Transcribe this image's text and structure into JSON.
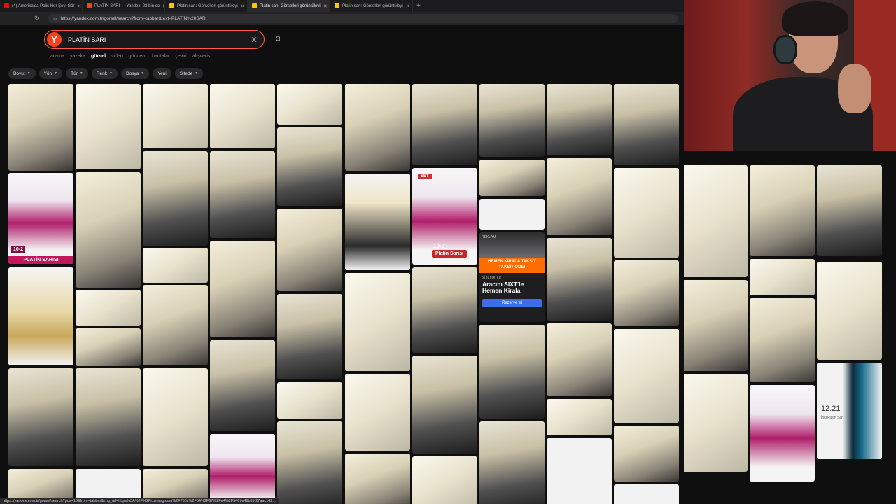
{
  "browser": {
    "tabs": [
      {
        "title": "(4) Amerika'da Polis Her Şeyi Gör",
        "color": "#ff0000"
      },
      {
        "title": "PLATİN SARI — Yandex: 23 bin so",
        "color": "#fc3f1d"
      },
      {
        "title": "Platin sarı: Görselleri görüntüleyi",
        "color": "#f9c400"
      },
      {
        "title": "Platin sarı: Görselleri görüntüleyi",
        "color": "#f9c400"
      },
      {
        "title": "Platin sarı: Görselleri görüntüleyi",
        "color": "#f9c400"
      }
    ],
    "new_tab": "+",
    "url": "https://yandex.com.tr/gorsel/search?from=tabbar&text=PLATİN%20SARI"
  },
  "search": {
    "logo": "Y",
    "query": "PLATİN SARI",
    "clear": "✕",
    "services": [
      "arama",
      "yazeka",
      "görsel",
      "video",
      "gündem",
      "haritalar",
      "çeviri",
      "alışveriş"
    ],
    "active_service": "görsel"
  },
  "filters": [
    "Boyut",
    "Yön",
    "Tür",
    "Renk",
    "Dosya",
    "Yeni",
    "Sitede"
  ],
  "tiles": {
    "platin_sarisi": "PLATİN SARISI",
    "box_label_102": "10-2",
    "set_badge": "SET",
    "platin_sarisi_box": "Platin Sarısı",
    "box_code": "10-2",
    "tube_code": "12.21",
    "tube_name": "İnci Platin Sarı"
  },
  "ad": {
    "label": "REKLAM",
    "banner": "HEMEN KİRALA TAKSİT TAKSİT ÖDE!",
    "domain": "sixt.com.tr",
    "title": "Aracını SIXT'le Hemen Kirala",
    "button": "Rezerve et"
  },
  "status_url": "https://yandex.com.tr/gorsel/search?pos=18&from=tabbar&img_url=https%3A%2F%2Fi.pinimg.com%2F736x%2F54%2F67%2Fe4%2F5467e49b19f27aac142..."
}
